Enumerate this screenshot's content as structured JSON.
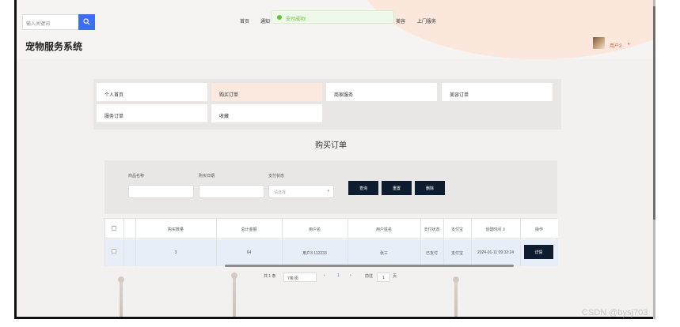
{
  "header": {
    "search_placeholder": "输入关键词",
    "nav": [
      "首页",
      "通知",
      "美容",
      "上门服务"
    ],
    "toast": "支付成功!",
    "site_title": "宠物服务系统",
    "user_name": "用户2",
    "caret": "▾"
  },
  "categories": [
    {
      "label": "个人首页",
      "active": false
    },
    {
      "label": "购买订单",
      "active": true
    },
    {
      "label": "商家服务",
      "active": false
    },
    {
      "label": "美容订单",
      "active": false
    },
    {
      "label": "服务订单",
      "active": false
    },
    {
      "label": "收藏",
      "active": false
    }
  ],
  "page": {
    "heading": "购买订单"
  },
  "filters": {
    "product_name_label": "商品名称",
    "purchase_date_label": "购买日期",
    "payment_status_label": "支付状态",
    "select_placeholder": "请选择",
    "buttons": [
      "查询",
      "重置",
      "删除"
    ]
  },
  "table": {
    "headers": [
      "购买数量",
      "总计金额",
      "用户名",
      "用户姓名",
      "支付状态",
      "支付宝",
      "创建时间 ⇕",
      "操作"
    ],
    "rows": [
      {
        "qty": "3",
        "total": "64",
        "user": "用户3 112233",
        "name": "张三",
        "status": "已支付",
        "pay": "支付宝",
        "time": "2024-01-11 09:32:24",
        "action": "详情"
      }
    ]
  },
  "pagination": {
    "total": "共 1 条",
    "page_size": "7条/页",
    "prev": "‹",
    "current": "1",
    "next": "›",
    "goto_label": "前往",
    "goto_value": "1",
    "page_suffix": "页"
  },
  "watermark": "CSDN @bysj703",
  "colors": {
    "primary_dark": "#0d1c2e",
    "accent_blue": "#3b6ef5",
    "peach": "#fbe9df",
    "success": "#67c23a"
  }
}
